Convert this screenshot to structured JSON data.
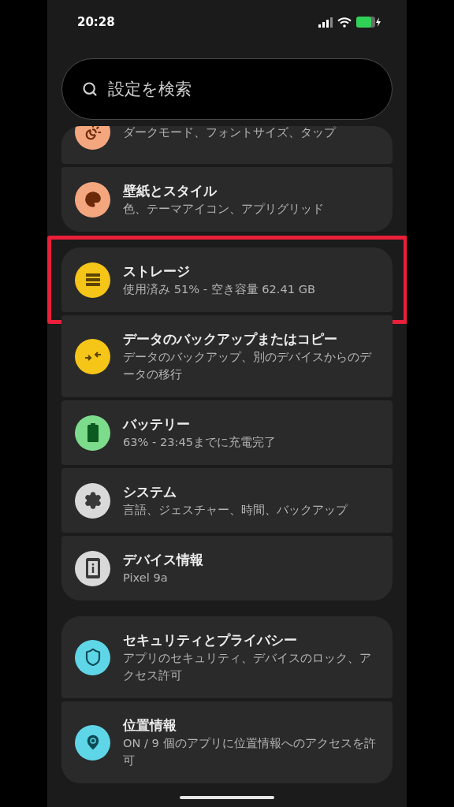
{
  "status_bar": {
    "time": "20:28"
  },
  "search": {
    "placeholder": "設定を検索"
  },
  "groups": [
    {
      "items": [
        {
          "kind": "display",
          "subtitle": "ダークモード、フォントサイズ、タップ",
          "color": "#f4a77f",
          "highlighted": false
        },
        {
          "kind": "palette",
          "title": "壁紙とスタイル",
          "subtitle": "色、テーマアイコン、アプリグリッド",
          "color": "#f4a77f",
          "highlighted": false
        }
      ]
    },
    {
      "items": [
        {
          "kind": "storage",
          "title": "ストレージ",
          "subtitle": "使用済み 51% - 空き容量 62.41 GB",
          "color": "#f5c518",
          "highlighted": true
        },
        {
          "kind": "transfer",
          "title": "データのバックアップまたはコピー",
          "subtitle": "データのバックアップ、別のデバイスからのデータの移行",
          "color": "#f5c518",
          "highlighted": false
        },
        {
          "kind": "battery",
          "title": "バッテリー",
          "subtitle": "63% - 23:45までに充電完了",
          "color": "#7ddc8c",
          "highlighted": false
        },
        {
          "kind": "gear",
          "title": "システム",
          "subtitle": "言語、ジェスチャー、時間、バックアップ",
          "color": "#d9d9d9",
          "highlighted": false
        },
        {
          "kind": "info",
          "title": "デバイス情報",
          "subtitle": "Pixel 9a",
          "color": "#d9d9d9",
          "highlighted": false
        }
      ]
    },
    {
      "items": [
        {
          "kind": "shield",
          "title": "セキュリティとプライバシー",
          "subtitle": "アプリのセキュリティ、デバイスのロック、アクセス許可",
          "color": "#5fd6e8",
          "highlighted": false
        },
        {
          "kind": "pin",
          "title": "位置情報",
          "subtitle": "ON / 9 個のアプリに位置情報へのアクセスを許可",
          "color": "#5fd6e8",
          "highlighted": false
        }
      ]
    }
  ]
}
